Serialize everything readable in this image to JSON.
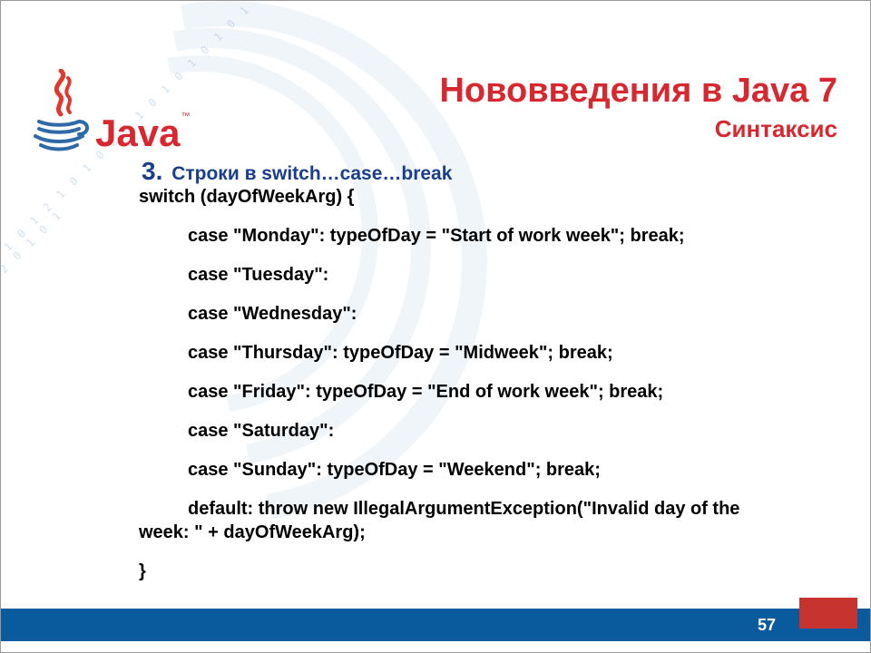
{
  "header": {
    "title": "Нововведения в Java 7",
    "subtitle": "Синтаксис"
  },
  "logo": {
    "text": "Java",
    "tm": "™"
  },
  "section": {
    "number": "3.",
    "title": "Строки в switch…case…break"
  },
  "code": {
    "l1": "switch (dayOfWeekArg) {",
    "l2": "case \"Monday\": typeOfDay = \"Start of work week\"; break;",
    "l3": "case \"Tuesday\":",
    "l4": "case \"Wednesday\":",
    "l5": "case \"Thursday\": typeOfDay = \"Midweek\"; break;",
    "l6": "case \"Friday\": typeOfDay = \"End of work week\"; break;",
    "l7": "case \"Saturday\":",
    "l8": "case \"Sunday\": typeOfDay = \"Weekend\"; break;",
    "l9a": "default: throw new IllegalArgumentException(\"Invalid day of the",
    "l9b": "week: \" + dayOfWeekArg);",
    "l10": "}"
  },
  "footer": {
    "page": "57"
  },
  "decoration": {
    "digits": "0 1 0 1 2 1 0\n 1 0 2 0 1 0 1\n0 1 0 1 0 1 0\n 1 2 0 1 0 1"
  }
}
